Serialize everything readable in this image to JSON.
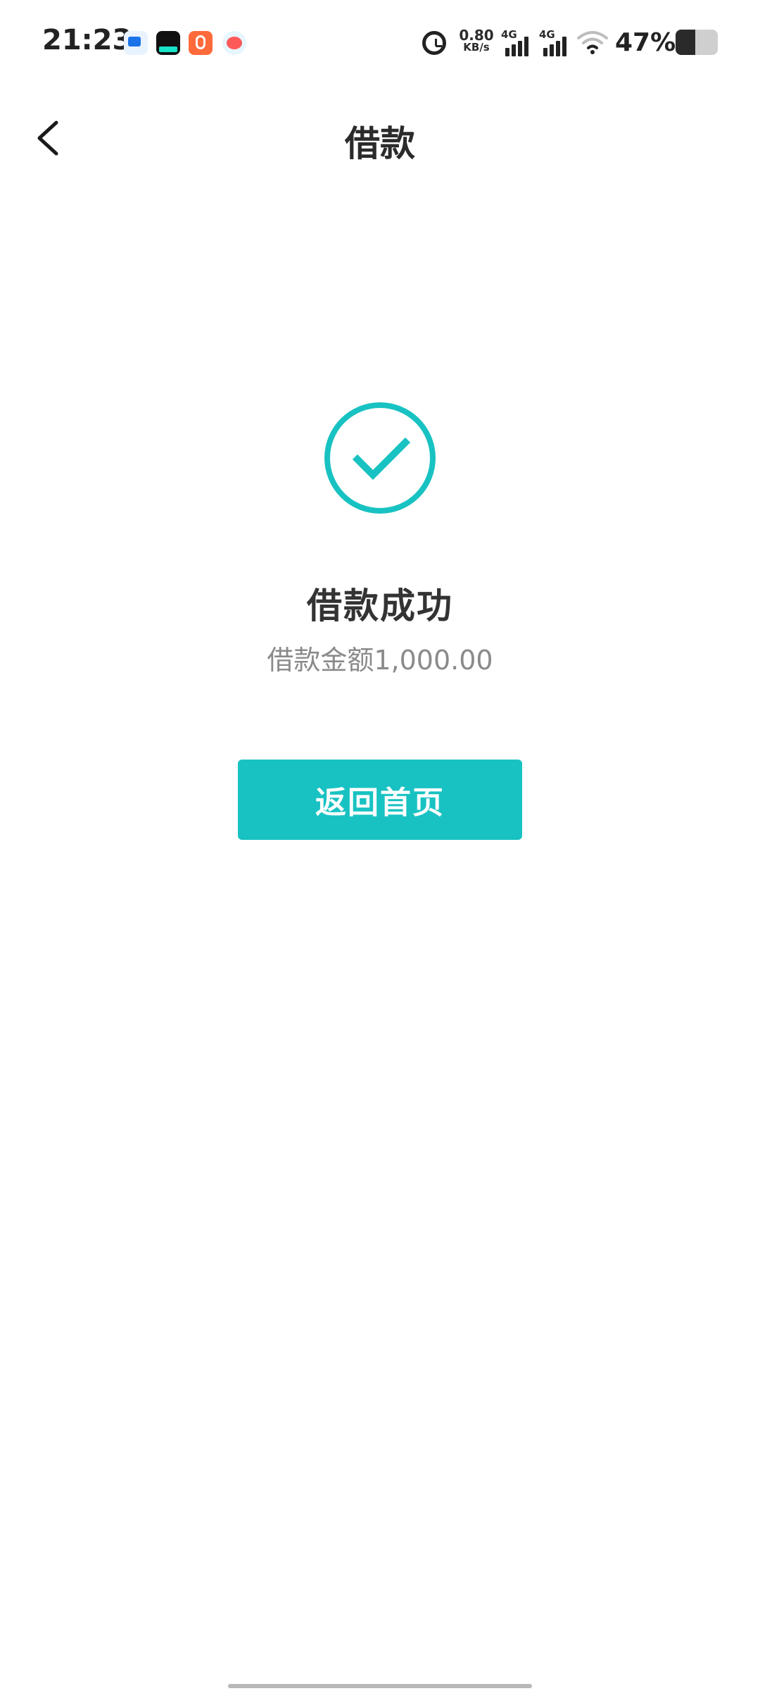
{
  "status_bar": {
    "time": "21:23",
    "net_speed_value": "0.80",
    "net_speed_unit": "KB/s",
    "signal_label_1": "4G",
    "signal_label_2": "4G",
    "battery_percent": "47%",
    "battery_level": 0.47
  },
  "header": {
    "title": "借款"
  },
  "result": {
    "title": "借款成功",
    "amount_line": "借款金额1,000.00",
    "accent_color": "#19c2c2"
  },
  "actions": {
    "home_label": "返回首页"
  }
}
